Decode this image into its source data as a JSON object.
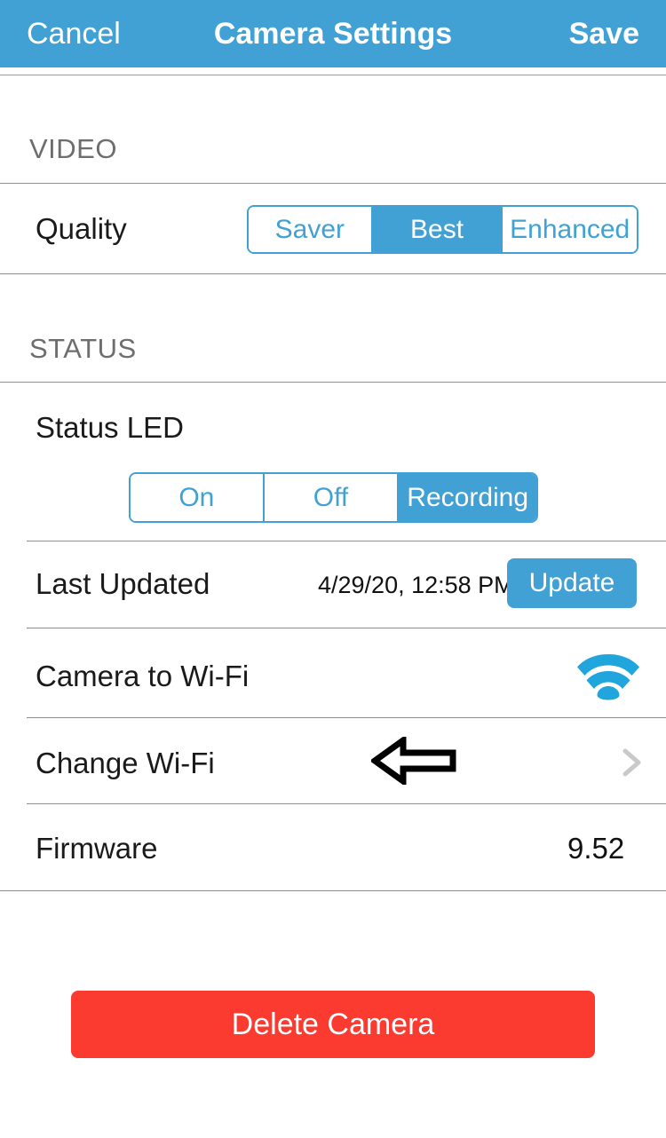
{
  "header": {
    "cancel_label": "Cancel",
    "title": "Camera Settings",
    "save_label": "Save",
    "background_color": "#41a1d5"
  },
  "sections": [
    {
      "id": "video",
      "title": "VIDEO",
      "rows": [
        {
          "id": "quality",
          "label": "Quality",
          "control": "segmented",
          "options": [
            "Saver",
            "Best",
            "Enhanced"
          ],
          "selected": "Best"
        }
      ]
    },
    {
      "id": "status",
      "title": "STATUS",
      "rows": [
        {
          "id": "status-led",
          "label": "Status LED",
          "control": "segmented",
          "options": [
            "On",
            "Off",
            "Recording"
          ],
          "selected": "Recording"
        },
        {
          "id": "last-updated",
          "label": "Last Updated",
          "value": "4/29/20, 12:58 PM",
          "button_label": "Update"
        },
        {
          "id": "camera-to-wifi",
          "label": "Camera to Wi-Fi",
          "icon": "wifi-icon"
        },
        {
          "id": "change-wifi",
          "label": "Change Wi-Fi",
          "icon": "chevron-right-icon",
          "annotation": "left-arrow-annotation"
        },
        {
          "id": "firmware",
          "label": "Firmware",
          "value": "9.52"
        }
      ]
    }
  ],
  "footer": {
    "delete_label": "Delete Camera",
    "delete_color": "#fb3b30"
  },
  "colors": {
    "accent": "#41a1d5",
    "danger": "#fb3b30",
    "separator": "#8e8e8e",
    "section_header_text": "#6e6e6e",
    "chevron": "#c9c9c9"
  }
}
